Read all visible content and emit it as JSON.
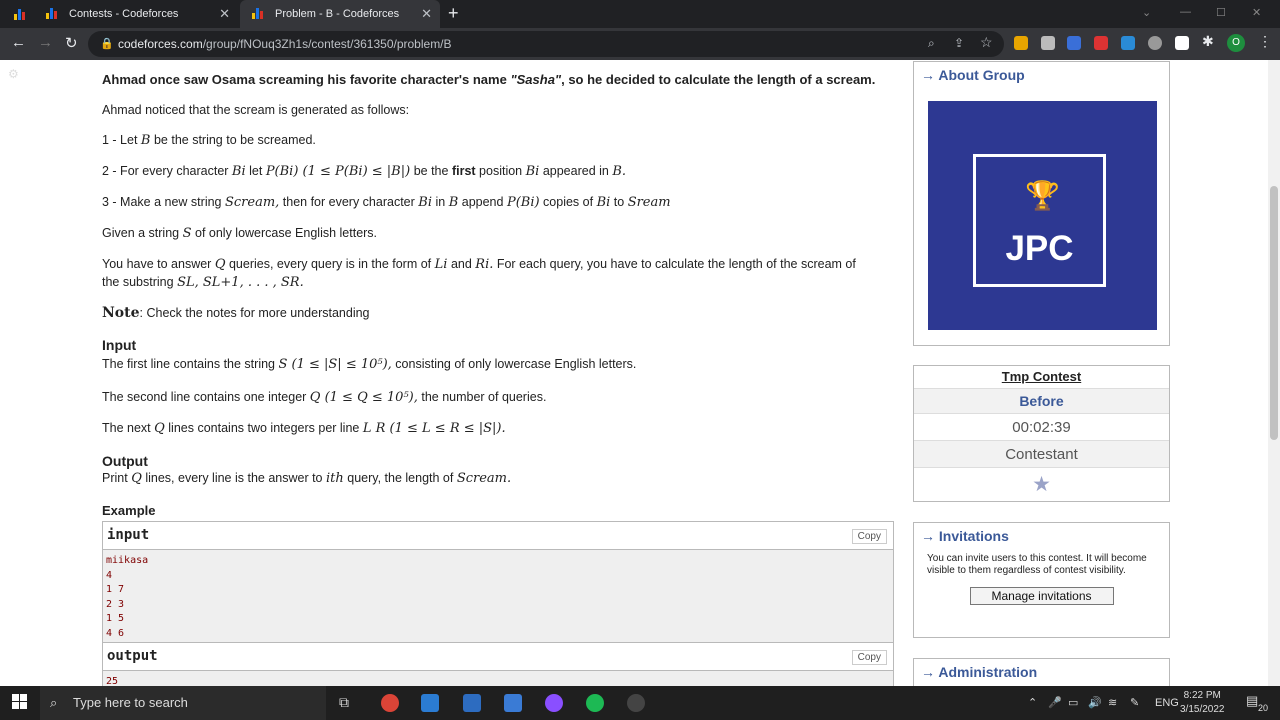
{
  "browser": {
    "tabs": [
      {
        "title": "Contests - Codeforces"
      },
      {
        "title": "Problem - B - Codeforces"
      }
    ],
    "url_host": "codeforces.com",
    "url_path": "/group/fNOuq3Zh1s/contest/361350/problem/B",
    "profile_initial": "O"
  },
  "statement": {
    "intro": "Ahmad once saw Osama screaming his favorite character's name",
    "name": "\"Sasha\"",
    "intro_end": ", so he decided to calculate the length of a scream.",
    "generated": "Ahmad noticed that the scream is generated as follows:",
    "s1a": "1 - Let",
    "s1m": "B",
    "s1b": "be the string to be screamed.",
    "s2a": "2 - For every character",
    "s2m1": "Bi",
    "s2b": "let",
    "s2m2": "P(Bi) (1 ≤ P(Bi) ≤ |B|)",
    "s2c": "be the",
    "s2d": "first",
    "s2e": "position",
    "s2m3": "Bi",
    "s2f": "appeared in",
    "s2m4": "B.",
    "s3a": "3 - Make a new string",
    "s3m1": "Scream,",
    "s3b": "then for every character",
    "s3m2": "Bi",
    "s3c": "in",
    "s3m3": "B",
    "s3d": "append",
    "s3m4": "P(Bi)",
    "s3e": "copies of",
    "s3m5": "Bi",
    "s3f": "to",
    "s3m6": "Sream",
    "given_a": "Given a string",
    "given_m": "S",
    "given_b": "of only lowercase English letters.",
    "q_a": "You have to answer",
    "q_m1": "Q",
    "q_b": "queries, every query is in the form of",
    "q_m2": "Li",
    "q_c": "and",
    "q_m3": "Ri.",
    "q_d": "For each query, you have to calculate the length of the scream of",
    "q2_a": "the substring",
    "q2_m": "SL, SL+1, . . . , SR.",
    "note_h": "Note",
    "note_t": ": Check the notes for more understanding"
  },
  "input_section": {
    "title": "Input",
    "l1a": "The first line contains the string",
    "l1m": "S (1 ≤ |S| ≤ 10⁵),",
    "l1b": "consisting of only lowercase English letters.",
    "l2a": "The second line contains one integer",
    "l2m": "Q (1 ≤ Q ≤ 10⁵),",
    "l2b": "the number of queries.",
    "l3a": "The next",
    "l3m1": "Q",
    "l3b": "lines contains two integers per line",
    "l3m2": "L R (1 ≤ L ≤ R ≤ |S|)."
  },
  "output_section": {
    "title": "Output",
    "a": "Print",
    "m1": "Q",
    "b": "lines, every line is the answer to",
    "m2": "ith",
    "c": "query, the length of",
    "m3": "Scream."
  },
  "example": {
    "title": "Example",
    "input_label": "input",
    "copy": "Copy",
    "input_lines": [
      "miikasa",
      "4",
      "1 7",
      "2 3",
      "1 5",
      "4 6"
    ],
    "output_label": "output",
    "output_lines": [
      "25"
    ]
  },
  "sidebar": {
    "about": "→ About Group",
    "logo_text": "JPC",
    "contest_name": "Tmp Contest",
    "phase": "Before",
    "timer": "00:02:39",
    "role": "Contestant",
    "invitations": "→ Invitations",
    "inv_text": "You can invite users to this contest. It will become visible to them regardless of contest visibility.",
    "manage": "Manage invitations",
    "admin": "→ Administration"
  },
  "taskbar": {
    "search": "Type here to search",
    "lang": "ENG",
    "time": "8:22 PM",
    "date": "3/15/2022",
    "notif": "20"
  }
}
